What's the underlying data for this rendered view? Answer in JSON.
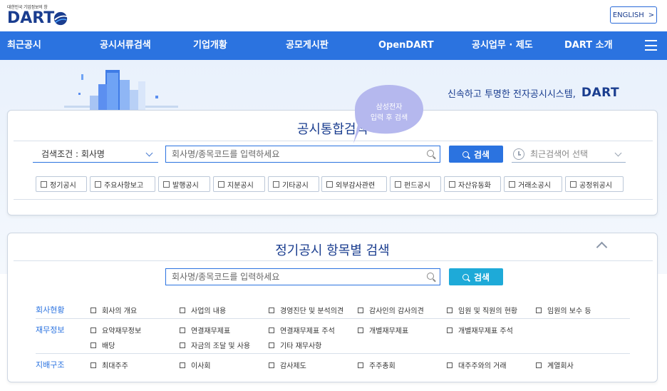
{
  "header": {
    "logo_tagline": "대한민국 기업정보의 창",
    "logo_text": "DART",
    "english_label": "ENGLISH",
    "english_arrow": ">"
  },
  "nav": {
    "items": [
      "최근공시",
      "공시서류검색",
      "기업개황",
      "공모게시판",
      "OpenDART",
      "공시업무 · 제도",
      "DART 소개"
    ]
  },
  "hero": {
    "tagline": "신속하고 투명한 전자공시시스템,",
    "tagline_brand": "DART"
  },
  "integrated_search": {
    "title": "공시통합검색",
    "condition_label": "검색조건 : 회사명",
    "input_placeholder": "회사명/종목코드를 입력하세요",
    "search_label": "검색",
    "recent_label": "최근검색어 선택",
    "tooltip_lines": [
      "삼성전자",
      "입력 후 검색"
    ],
    "categories": [
      "정기공시",
      "주요사항보고",
      "발행공시",
      "지분공시",
      "기타공시",
      "외부감사관련",
      "펀드공시",
      "자산유동화",
      "거래소공시",
      "공정위공시"
    ]
  },
  "periodic_search": {
    "title": "정기공시 항목별 검색",
    "input_placeholder": "회사명/종목코드를 입력하세요",
    "search_label": "검색",
    "rows": [
      {
        "label": "회사현황",
        "items": [
          "회사의 개요",
          "사업의 내용",
          "경영진단 및 분석의견",
          "감사인의 감사의견",
          "임원 및 직원의 현황",
          "임원의 보수 등"
        ]
      },
      {
        "label": "재무정보",
        "items": [
          "요약재무정보",
          "연결재무제표",
          "연결재무제표 주석",
          "개별재무제표",
          "개별재무제표 주석",
          "배당",
          "자금의 조달 및 사용",
          "기타 재무사항"
        ]
      },
      {
        "label": "지배구조",
        "items": [
          "최대주주",
          "이사회",
          "감사제도",
          "주주총회",
          "대주주와의 거래",
          "계열회사"
        ]
      }
    ]
  },
  "colors": {
    "nav_blue": "#2b73e0",
    "brand_navy": "#1a3d8f",
    "teal_button": "#1eaad8",
    "tooltip_purple": "#b5b8ee"
  }
}
